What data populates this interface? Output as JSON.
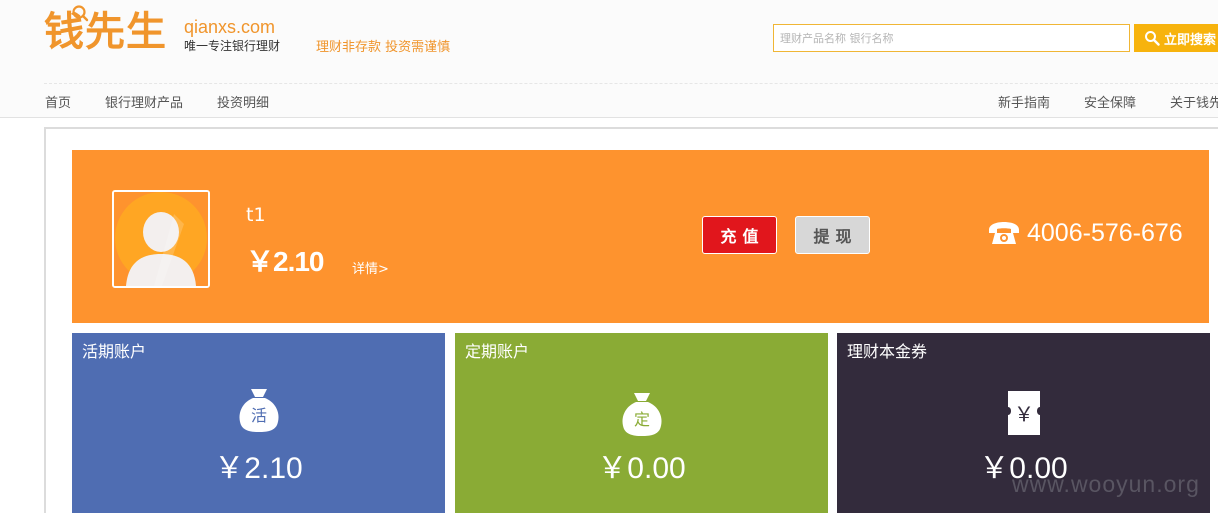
{
  "header": {
    "logo_cn": "钱先生",
    "logo_en": "qianxs.com",
    "logo_sub": "唯一专注银行理财",
    "slogan": "理财非存款 投资需谨慎",
    "search_placeholder": "理财产品名称 银行名称",
    "search_button": "立即搜索"
  },
  "nav_left": [
    "首页",
    "银行理财产品",
    "投资明细"
  ],
  "nav_right": [
    "新手指南",
    "安全保障",
    "关于钱先生"
  ],
  "user": {
    "name": "t1",
    "balance": "￥2.10",
    "details_link": "详情>"
  },
  "actions": {
    "recharge": "充值",
    "withdraw": "提现"
  },
  "phone": "4006-576-676",
  "cards": [
    {
      "title": "活期账户",
      "icon_char": "活",
      "amount": "￥2.10",
      "color": "#4f6db2"
    },
    {
      "title": "定期账户",
      "icon_char": "定",
      "amount": "￥0.00",
      "color": "#8aab35"
    },
    {
      "title": "理财本金券",
      "icon_char": "￥",
      "amount": "￥0.00",
      "color": "#332b3c"
    }
  ],
  "watermark": "www.wooyun.org",
  "colors": {
    "brand_orange": "#f0952c",
    "banner": "#fe932e",
    "recharge_red": "#e1161c",
    "search_yellow": "#f7b30d"
  }
}
